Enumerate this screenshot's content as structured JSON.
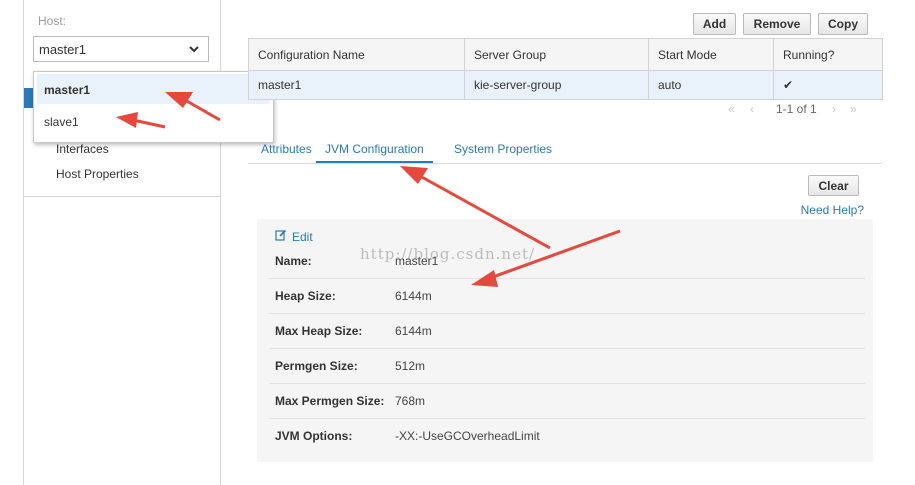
{
  "sidebar": {
    "host_label": "Host:",
    "selected_host": "master1",
    "links": [
      "Interfaces",
      "Host Properties"
    ]
  },
  "host_dropdown": {
    "options": [
      "master1",
      "slave1"
    ],
    "selected": "master1"
  },
  "toolbar": {
    "add_label": "Add",
    "remove_label": "Remove",
    "copy_label": "Copy"
  },
  "table": {
    "columns": [
      "Configuration Name",
      "Server Group",
      "Start Mode",
      "Running?"
    ],
    "rows": [
      {
        "name": "master1",
        "server_group": "kie-server-group",
        "start_mode": "auto",
        "running": "✔"
      }
    ]
  },
  "pager": {
    "first": "«",
    "prev": "‹",
    "text": "1-1 of 1",
    "next": "›",
    "last": "»"
  },
  "tabs": [
    "Attributes",
    "JVM Configuration",
    "System Properties"
  ],
  "active_tab": "JVM Configuration",
  "clear_label": "Clear",
  "need_help_label": "Need Help?",
  "jvm": {
    "edit_label": "Edit",
    "attributes": [
      {
        "key": "Name:",
        "value": "master1"
      },
      {
        "key": "Heap Size:",
        "value": "6144m"
      },
      {
        "key": "Max Heap Size:",
        "value": "6144m"
      },
      {
        "key": "Permgen Size:",
        "value": "512m"
      },
      {
        "key": "Max Permgen Size:",
        "value": "768m"
      },
      {
        "key": "JVM Options:",
        "value": "-XX:-UseGCOverheadLimit"
      }
    ]
  },
  "watermark": "http://blog.csdn.net/",
  "colors": {
    "link": "#2a7ab8",
    "selected_row": "#e9f2fa",
    "annotation_arrow": "#e8473c"
  }
}
